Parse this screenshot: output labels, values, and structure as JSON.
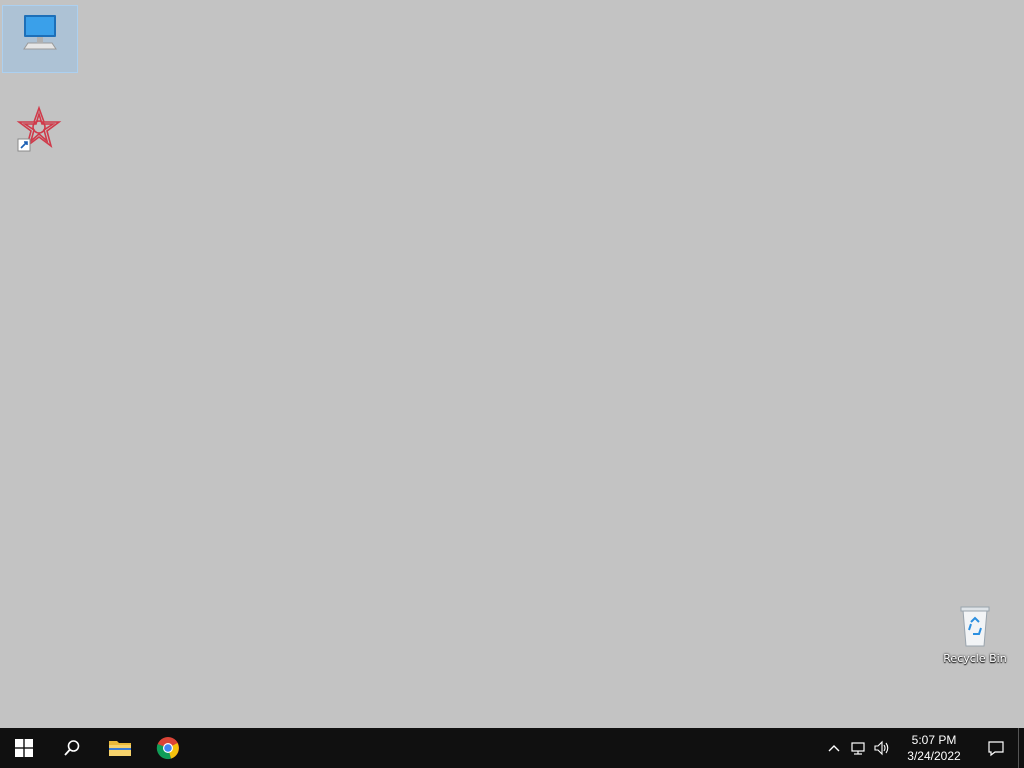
{
  "desktop": {
    "background": "#c3c3c3",
    "icons": [
      {
        "name": "This PC",
        "label": ""
      },
      {
        "name": "Shortcut",
        "label": ""
      },
      {
        "name": "Recycle Bin",
        "label": "Recycle Bin"
      }
    ]
  },
  "taskbar": {
    "start": "Start",
    "search": "Search",
    "pinned": [
      "File Explorer",
      "Google Chrome"
    ],
    "clock": {
      "time": "5:07 PM",
      "date": "3/24/2022"
    }
  },
  "colors": {
    "taskbar": "#101010",
    "accent": "#2b8fe0",
    "folder": "#e9b93b"
  }
}
